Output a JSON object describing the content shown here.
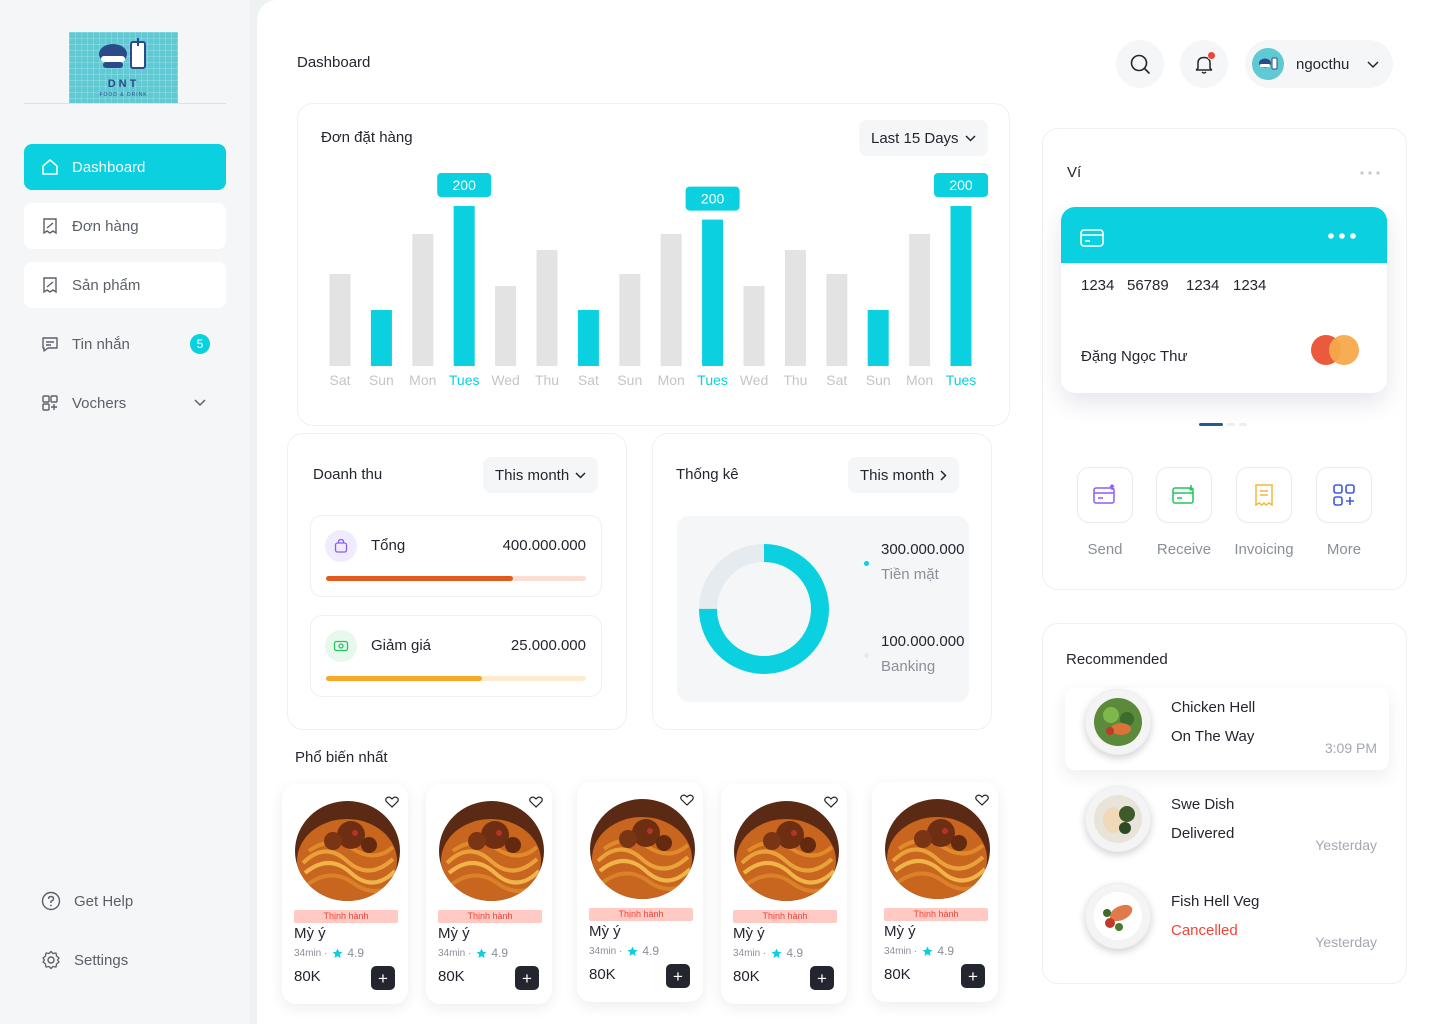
{
  "logo": {
    "text": "DNT",
    "sub": "FOOD & DRINK"
  },
  "sidebar": {
    "items": [
      {
        "label": "Dashboard",
        "icon": "home-icon",
        "active": true
      },
      {
        "label": "Đơn hàng",
        "icon": "receipt-icon"
      },
      {
        "label": "Sản phẩm",
        "icon": "receipt-icon"
      },
      {
        "label": "Tin nhắn",
        "icon": "message-icon",
        "badge": "5"
      },
      {
        "label": "Vochers",
        "icon": "voucher-icon"
      }
    ],
    "bottom": [
      {
        "label": "Get Help",
        "icon": "help-icon"
      },
      {
        "label": "Settings",
        "icon": "settings-icon"
      }
    ]
  },
  "header": {
    "title": "Dashboard",
    "user": {
      "name": "ngocthu"
    }
  },
  "orders": {
    "title": "Đơn đặt hàng",
    "filter": "Last 15 Days"
  },
  "chart_data": {
    "type": "bar",
    "categories": [
      "Sat",
      "Sun",
      "Mon",
      "Tues",
      "Wed",
      "Thu",
      "Sat",
      "Sun",
      "Mon",
      "Tues",
      "Wed",
      "Thu",
      "Sat",
      "Sun",
      "Mon",
      "Tues"
    ],
    "values": [
      115,
      70,
      165,
      200,
      100,
      145,
      70,
      115,
      165,
      183,
      100,
      145,
      115,
      70,
      165,
      200
    ],
    "highlighted": [
      1,
      3,
      6,
      9,
      13,
      15
    ],
    "data_labels": {
      "3": "200",
      "9": "200",
      "15": "200"
    },
    "ylim": [
      0,
      200
    ],
    "colors": {
      "normal": "#e3e3e3",
      "highlight": "#0bd0e0"
    },
    "grid": false,
    "title": "",
    "xlabel": "",
    "ylabel": ""
  },
  "revenue": {
    "title": "Doanh thu",
    "filter": "This month",
    "rows": [
      {
        "label": "Tổng",
        "value": "400.000.000",
        "progress": 0.72,
        "color": "#e25a1c",
        "track": "#fbdfd2"
      },
      {
        "label": "Giảm giá",
        "value": "25.000.000",
        "progress": 0.6,
        "color": "#f7a928",
        "track": "#fdebd0"
      }
    ]
  },
  "stats": {
    "title": "Thống kê",
    "filter": "This month",
    "donut": [
      {
        "label": "Tiền mặt",
        "value": "300.000.000",
        "share": 0.75,
        "color": "#0bd0e0"
      },
      {
        "label": "Banking",
        "value": "100.000.000",
        "share": 0.25,
        "color": "#e6ebef"
      }
    ]
  },
  "popular": {
    "title": "Phổ biến nhất",
    "items": [
      {
        "tag": "Thịnh hành",
        "name": "Mỳ ý",
        "time": "34min ·",
        "rating": "4.9",
        "price": "80K"
      },
      {
        "tag": "Thịnh hành",
        "name": "Mỳ ý",
        "time": "34min ·",
        "rating": "4.9",
        "price": "80K"
      },
      {
        "tag": "Thịnh hành",
        "name": "Mỳ ý",
        "time": "34min ·",
        "rating": "4.9",
        "price": "80K"
      },
      {
        "tag": "Thịnh hành",
        "name": "Mỳ ý",
        "time": "34min ·",
        "rating": "4.9",
        "price": "80K"
      },
      {
        "tag": "Thịnh hành",
        "name": "Mỳ ý",
        "time": "34min ·",
        "rating": "4.9",
        "price": "80K"
      }
    ]
  },
  "wallet": {
    "title": "Ví",
    "card_numbers": [
      "1234",
      "56789",
      "1234",
      "1234"
    ],
    "holder": "Đặng Ngọc Thư",
    "actions": [
      {
        "label": "Send",
        "icon": "send-icon",
        "color": "#8b5cf6"
      },
      {
        "label": "Receive",
        "icon": "receive-icon",
        "color": "#22c55e"
      },
      {
        "label": "Invoicing",
        "icon": "invoice-icon",
        "color": "#f5b73b"
      },
      {
        "label": "More",
        "icon": "more-grid-icon",
        "color": "#3b5bdb"
      }
    ]
  },
  "recommended": {
    "title": "Recommended",
    "items": [
      {
        "name": "Chicken Hell",
        "status": "On The Way",
        "time": "3:09 PM",
        "status_color": "#23262f"
      },
      {
        "name": "Swe Dish",
        "status": "Delivered",
        "time": "Yesterday",
        "status_color": "#23262f"
      },
      {
        "name": "Fish Hell Veg",
        "status": "Cancelled",
        "time": "Yesterday",
        "status_color": "#f04438"
      }
    ]
  }
}
